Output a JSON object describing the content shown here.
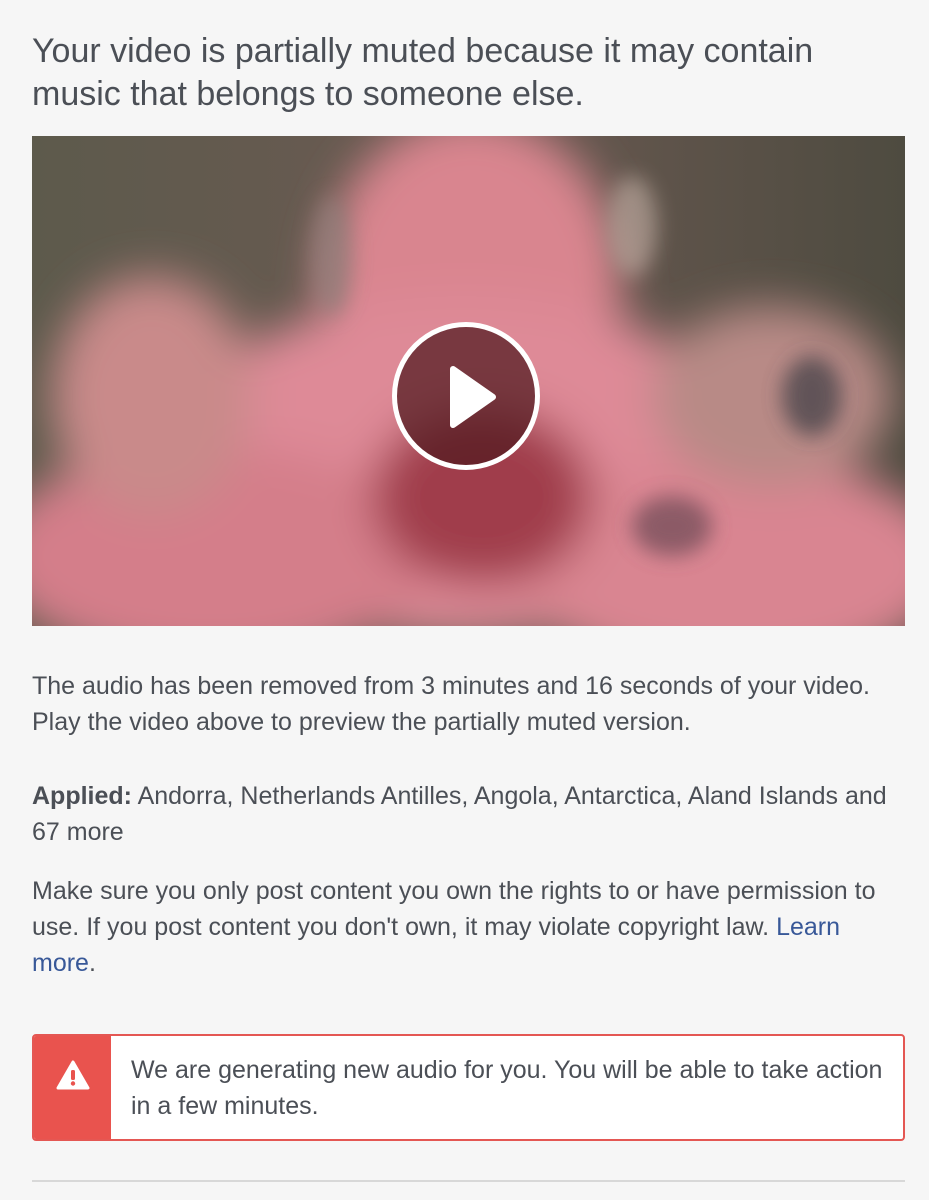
{
  "dialog": {
    "title": "Your video is partially muted because it may contain music that belongs to someone else."
  },
  "video": {
    "play_icon": "play-icon"
  },
  "body": {
    "muted_info": "The audio has been removed from 3 minutes and 16 seconds of your video. Play the video above to preview the partially muted version.",
    "applied_label": "Applied:",
    "applied_regions": " Andorra, Netherlands Antilles, Angola, Antarctica, Aland Islands and 67 more",
    "rights_notice": "Make sure you only post content you own the rights to or have permission to use. If you post content you don't own, it may violate copyright law. ",
    "learn_more": "Learn more",
    "learn_more_suffix": "."
  },
  "alert": {
    "icon": "warning-icon",
    "message": "We are generating new audio for you. You will be able to take action in a few minutes.",
    "accent_color": "#e9534e"
  },
  "colors": {
    "text": "#4b4f56",
    "link": "#385898",
    "background": "#f6f6f6"
  }
}
